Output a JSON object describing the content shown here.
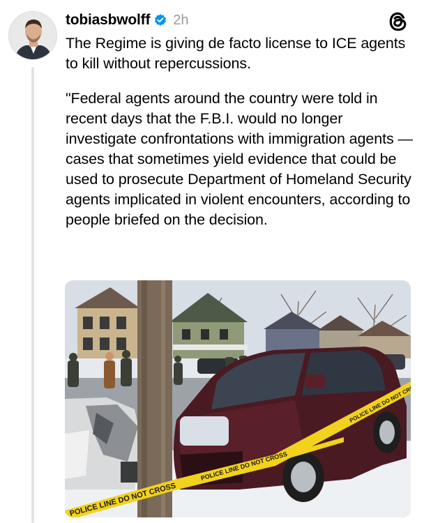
{
  "post": {
    "username": "tobiasbwolff",
    "timestamp": "2h",
    "paragraphs": [
      "The Regime is giving de facto license to ICE agents to kill without repercussions.",
      "\"Federal agents around the country were told in recent days that the F.B.I. would no longer investigate confrontations with immigration agents — cases that sometimes yield evidence that could be used to prosecute Department of Homeland Security agents implicated in violent encounters, according to people briefed on the decision."
    ]
  },
  "media": {
    "tape_texts": [
      "POLICE LINE DO NOT CROSS",
      "POLICE LINE DO NOT CROSS",
      "POLICE LINE DO NOT CROSS"
    ]
  },
  "colors": {
    "verified_badge": "#0095f6",
    "timestamp": "#9a9a9a",
    "suv": "#4a1a22",
    "police_tape": "#f2d21c"
  },
  "icons": {
    "verified": "verified-badge-icon",
    "app": "threads-logo-icon"
  }
}
